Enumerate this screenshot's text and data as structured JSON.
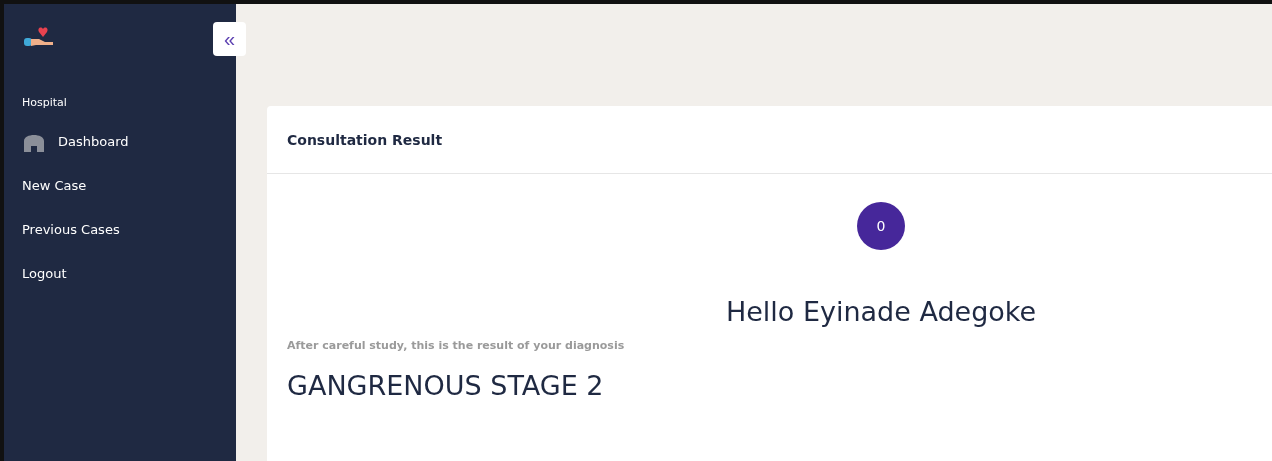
{
  "sidebar": {
    "section_label": "Hospital",
    "items": [
      {
        "label": "Dashboard",
        "kind": "icon_link"
      },
      {
        "label": "New Case",
        "kind": "link"
      },
      {
        "label": "Previous Cases",
        "kind": "link"
      },
      {
        "label": "Logout",
        "kind": "link"
      }
    ]
  },
  "collapse_button": {
    "label": "«"
  },
  "card": {
    "title": "Consultation Result",
    "avatar": "0",
    "greeting": "Hello Eyinade Adegoke",
    "intro": "After careful study, this is the result of your diagnosis",
    "diagnosis": "GANGRENOUS STAGE 2"
  }
}
